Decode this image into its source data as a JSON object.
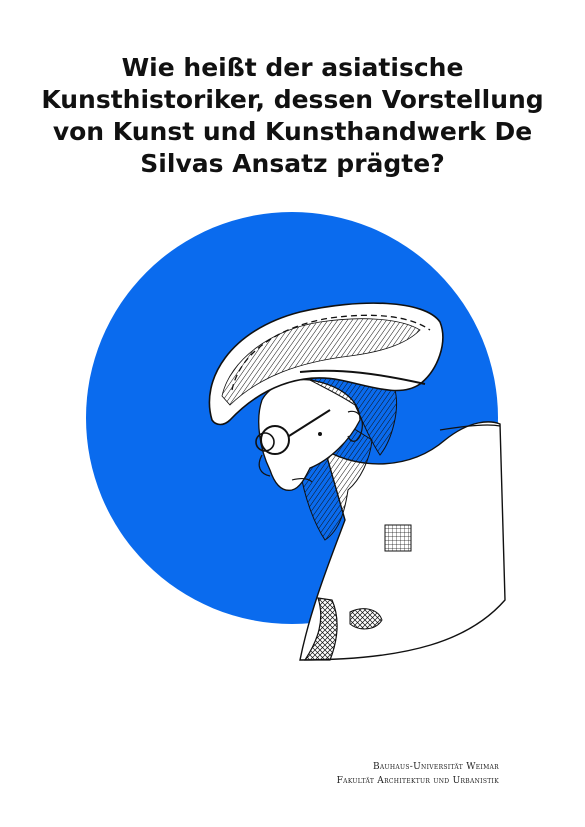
{
  "question": {
    "lines": [
      "Wie heißt der asiatische",
      "Kunsthistoriker, dessen Vorstellung",
      "von Kunst und Kunsthandwerk De",
      "Silvas Ansatz prägte?"
    ]
  },
  "illustration": {
    "circle_color": "#0a6bee",
    "subject_icon": "man-with-hat-sketch-icon"
  },
  "footer": {
    "line1": "Bauhaus-Universität Weimar",
    "line2": "Fakultät Architektur und Urbanistik"
  }
}
